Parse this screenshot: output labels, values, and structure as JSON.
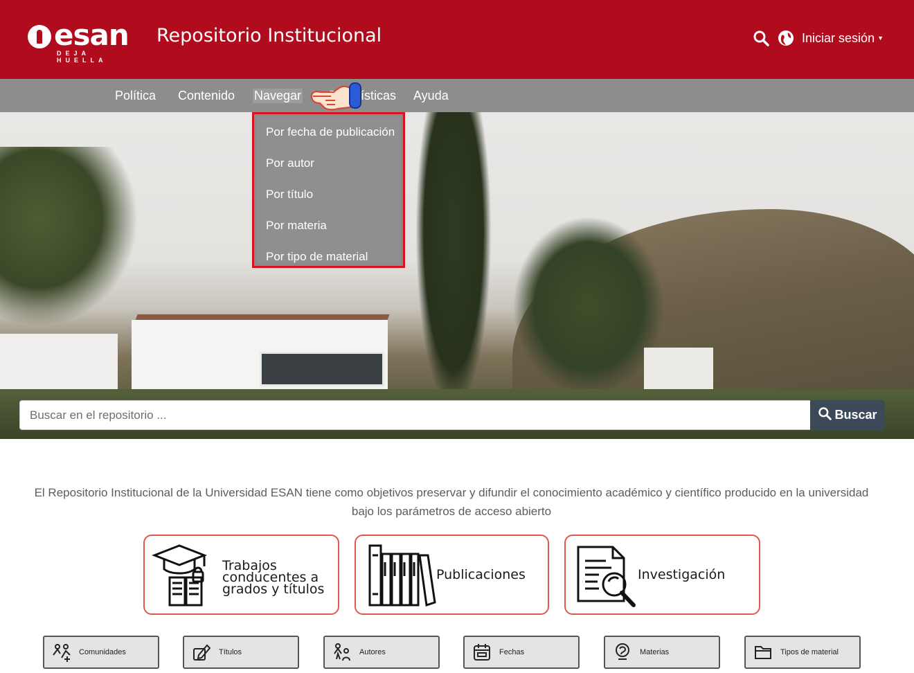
{
  "header": {
    "logo_word": "esan",
    "logo_tagline": "DEJA HUELLA",
    "title": "Repositorio Institucional",
    "login_label": "Iniciar sesión",
    "brand_color": "#b10c1d"
  },
  "nav": {
    "items": [
      {
        "label": "Política"
      },
      {
        "label": "Contenido"
      },
      {
        "label": "Navegar"
      },
      {
        "label": "Estadísticas"
      },
      {
        "label": "Ayuda"
      }
    ]
  },
  "dropdown": {
    "items": [
      {
        "label": "Por fecha de publicación"
      },
      {
        "label": "Por autor"
      },
      {
        "label": "Por título"
      },
      {
        "label": "Por materia"
      },
      {
        "label": "Por tipo de material"
      }
    ],
    "highlight_color": "#d6141f"
  },
  "search": {
    "placeholder": "Buscar en el repositorio ...",
    "button_label": "Buscar"
  },
  "description": "El Repositorio Institucional de la Universidad ESAN tiene como objetivos preservar y difundir el conocimiento académico y científico producido en la universidad bajo los parámetros de acceso abierto",
  "categories": [
    {
      "label_1": "Trabajos",
      "label_2": "conducentes a",
      "label_3": "grados y títulos",
      "icon": "graduation-books-icon"
    },
    {
      "label": "Publicaciones",
      "icon": "library-books-icon"
    },
    {
      "label": "Investigación",
      "icon": "document-magnifier-icon"
    }
  ],
  "quick_links": [
    {
      "label": "Comunidades",
      "icon": "community-icon"
    },
    {
      "label": "Títulos",
      "icon": "edit-note-icon"
    },
    {
      "label": "Autores",
      "icon": "authors-icon"
    },
    {
      "label": "Fechas",
      "icon": "calendar-icon"
    },
    {
      "label": "Materias",
      "icon": "subject-icon"
    },
    {
      "label": "Tipos de material",
      "icon": "folder-icon"
    }
  ]
}
